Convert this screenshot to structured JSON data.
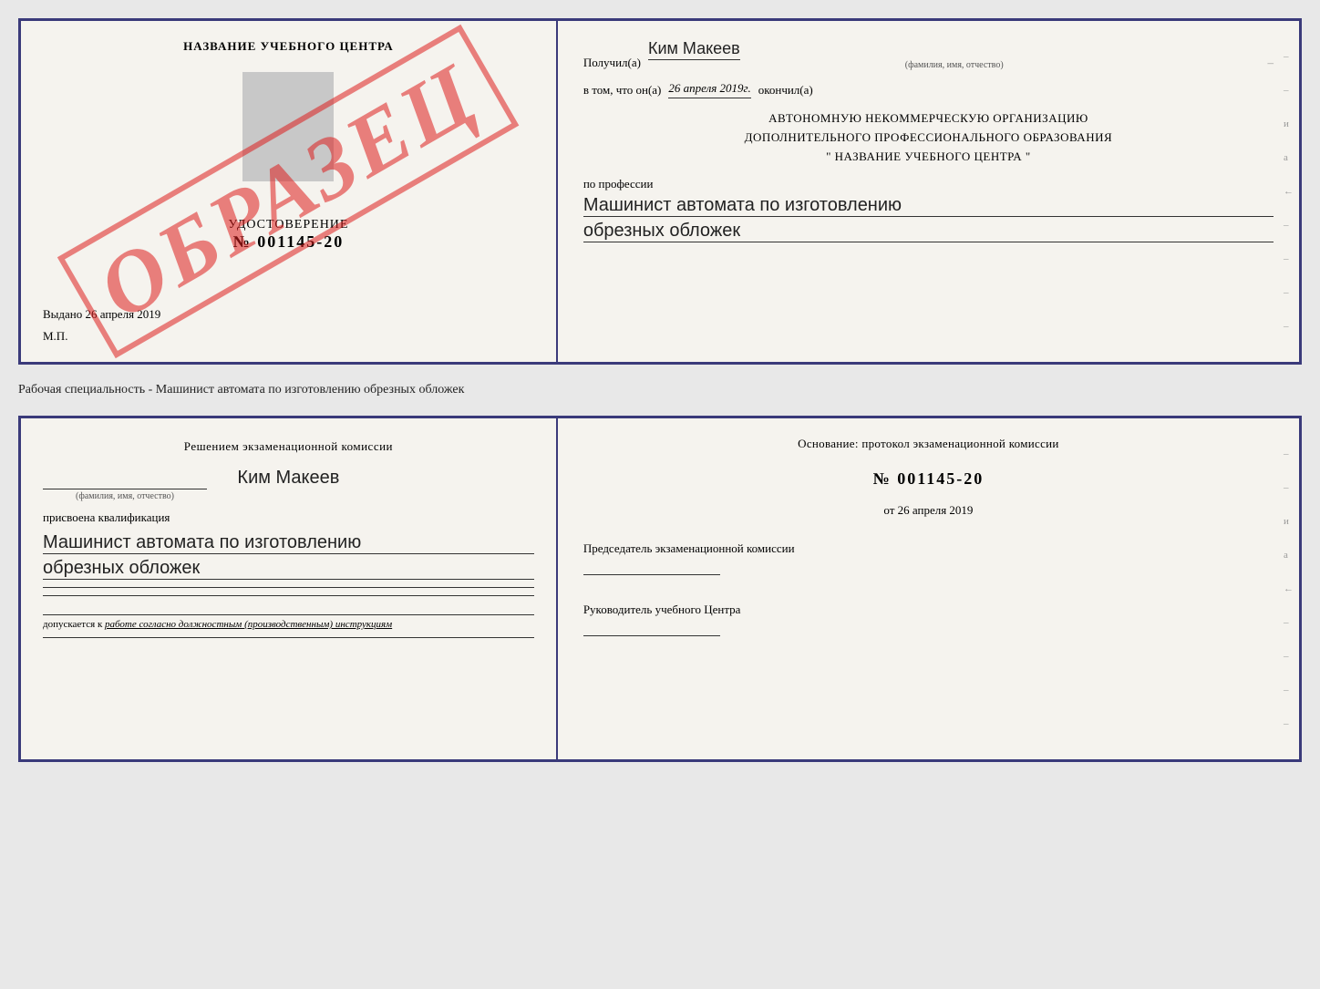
{
  "top_document": {
    "left": {
      "school_name": "НАЗВАНИЕ УЧЕБНОГО ЦЕНТРА",
      "watermark": "ОБРАЗЕЦ",
      "udostoverenie_label": "УДОСТОВЕРЕНИЕ",
      "udostoverenie_number": "№ 001145-20",
      "vydano_label": "Выдано",
      "vydano_date": "26 апреля 2019",
      "mp_label": "М.П."
    },
    "right": {
      "recipient_prefix": "Получил(а)",
      "recipient_name": "Ким Макеев",
      "fio_label": "(фамилия, имя, отчество)",
      "date_prefix": "в том, что он(а)",
      "date_value": "26 апреля 2019г.",
      "date_suffix": "окончил(а)",
      "org_line1": "АВТОНОМНУЮ НЕКОММЕРЧЕСКУЮ ОРГАНИЗАЦИЮ",
      "org_line2": "ДОПОЛНИТЕЛЬНОГО ПРОФЕССИОНАЛЬНОГО ОБРАЗОВАНИЯ",
      "org_line3": "\" НАЗВАНИЕ УЧЕБНОГО ЦЕНТРА \"",
      "profession_label": "по профессии",
      "profession_line1": "Машинист автомата по изготовлению",
      "profession_line2": "обрезных обложек"
    }
  },
  "specialty_label": "Рабочая специальность - Машинист автомата по изготовлению обрезных обложек",
  "bottom_document": {
    "left": {
      "commission_label": "Решением экзаменационной комиссии",
      "person_name": "Ким Макеев",
      "fio_label": "(фамилия, имя, отчество)",
      "kvali_label": "присвоена квалификация",
      "qualification_line1": "Машинист автомата по изготовлению",
      "qualification_line2": "обрезных обложек",
      "допуск_prefix": "допускается к",
      "допуск_italic": "работе согласно должностным (производственным) инструкциям"
    },
    "right": {
      "osnov_label": "Основание: протокол экзаменационной комиссии",
      "protocol_number": "№ 001145-20",
      "date_prefix": "от",
      "date_value": "26 апреля 2019",
      "chairman_label": "Председатель экзаменационной комиссии",
      "руководитель_label": "Руководитель учебного Центра"
    }
  }
}
